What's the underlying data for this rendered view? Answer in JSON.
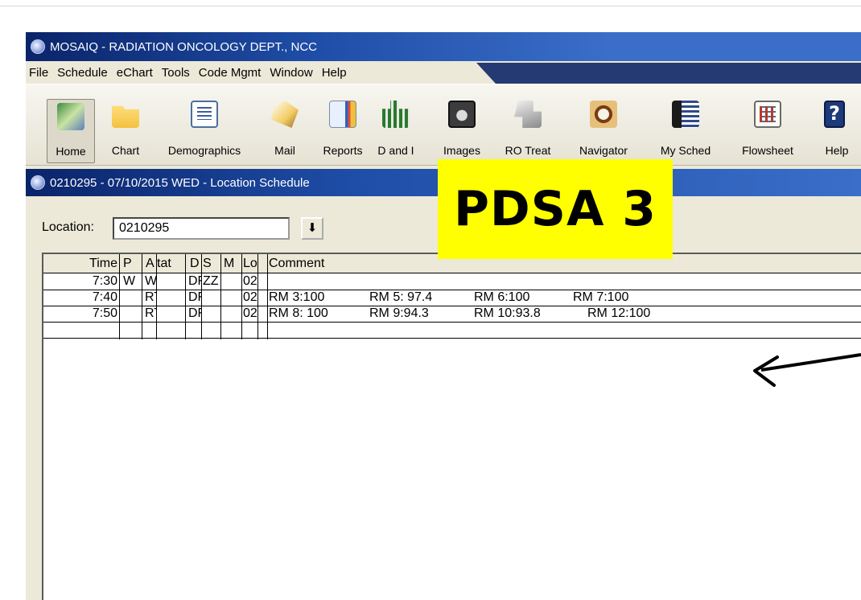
{
  "app": {
    "title": "MOSAIQ - RADIATION ONCOLOGY DEPT., NCC"
  },
  "menu": [
    "File",
    "Schedule",
    "eChart",
    "Tools",
    "Code Mgmt",
    "Window",
    "Help"
  ],
  "toolbar": [
    {
      "label": "Home",
      "icon": "home-icon",
      "active": true
    },
    {
      "label": "Chart",
      "icon": "folder-icon"
    },
    {
      "label": "Demographics",
      "icon": "id-card-icon"
    },
    {
      "label": "Mail",
      "icon": "mail-icon"
    },
    {
      "label": "Reports",
      "icon": "reports-icon"
    },
    {
      "label": "D and I",
      "icon": "dx-icon"
    },
    {
      "label": "Images",
      "icon": "xray-icon"
    },
    {
      "label": "RO Treat",
      "icon": "treatment-machine-icon"
    },
    {
      "label": "Navigator",
      "icon": "navigator-icon"
    },
    {
      "label": "My Sched",
      "icon": "schedule-icon"
    },
    {
      "label": "Flowsheet",
      "icon": "flowsheet-icon"
    },
    {
      "label": "Help",
      "icon": "help-icon"
    }
  ],
  "window": {
    "title": "0210295 - 07/10/2015  WED - Location Schedule"
  },
  "location": {
    "label": "Location:",
    "value": "0210295",
    "dropdown_glyph": "⬇"
  },
  "grid": {
    "headers": [
      "Time",
      "P",
      "A",
      "tat",
      "D",
      "S",
      "M",
      "Lo",
      "Comment"
    ],
    "rows": [
      {
        "time": "7:30",
        "p": "W",
        "a": "W",
        "tat": "",
        "d": "DF",
        "s": "ZZ",
        "m": "",
        "lo": "02",
        "comment": [
          "",
          "",
          "",
          ""
        ]
      },
      {
        "time": "7:40",
        "p": "",
        "a": "RT",
        "tat": "",
        "d": "DF",
        "s": "",
        "m": "",
        "lo": "02",
        "comment": [
          "RM 3:100",
          "RM 5: 97.4",
          "RM 6:100",
          "RM 7:100"
        ]
      },
      {
        "time": "7:50",
        "p": "",
        "a": "RT",
        "tat": "",
        "d": "DF",
        "s": "",
        "m": "",
        "lo": "02",
        "comment": [
          "RM 8: 100",
          "RM 9:94.3",
          "RM 10:93.8",
          "RM 12:100"
        ]
      }
    ]
  },
  "callout": {
    "text": "PDSA 3",
    "background": "#ffff00"
  },
  "colors": {
    "titlebar": "#0a246a",
    "chrome": "#ece9d8"
  }
}
